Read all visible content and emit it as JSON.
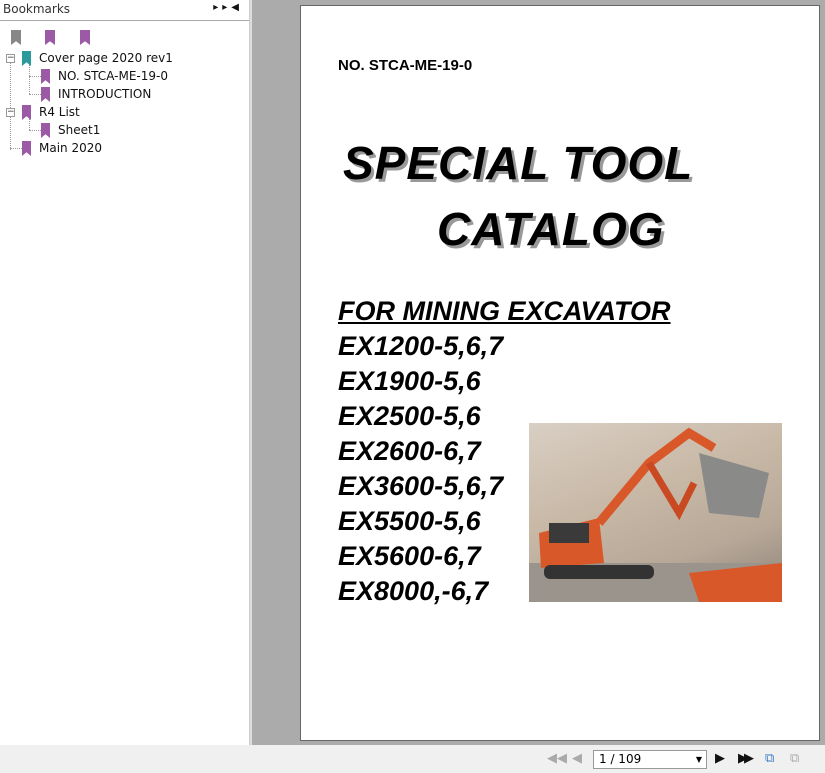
{
  "sidebar": {
    "title": "Bookmarks",
    "tools": [
      "delete-bookmark-icon",
      "add-bookmark-icon",
      "go-to-bookmark-icon"
    ],
    "items": [
      {
        "label": "Cover page 2020 rev1",
        "level": 0,
        "expanded": true,
        "color": "#2a9a9a"
      },
      {
        "label": "NO. STCA-ME-19-0",
        "level": 1,
        "color": "#9b59a6"
      },
      {
        "label": "INTRODUCTION",
        "level": 1,
        "color": "#9b59a6"
      },
      {
        "label": "R4 List",
        "level": 0,
        "expanded": true,
        "color": "#9b59a6"
      },
      {
        "label": "Sheet1",
        "level": 1,
        "color": "#9b59a6"
      },
      {
        "label": "Main 2020",
        "level": 0,
        "color": "#9b59a6"
      }
    ]
  },
  "document": {
    "doc_no": "NO. STCA-ME-19-0",
    "title1": "SPECIAL TOOL",
    "title2": "CATALOG",
    "subtitle": "FOR MINING EXCAVATOR",
    "models": [
      "EX1200-5,6,7",
      "EX1900-5,6",
      "EX2500-5,6",
      "EX2600-6,7",
      "EX3600-5,6,7",
      "EX5500-5,6",
      "EX5600-6,7",
      "EX8000,-6,7"
    ]
  },
  "nav": {
    "page_display": "1 / 109",
    "current_page": 1,
    "total_pages": 109
  }
}
